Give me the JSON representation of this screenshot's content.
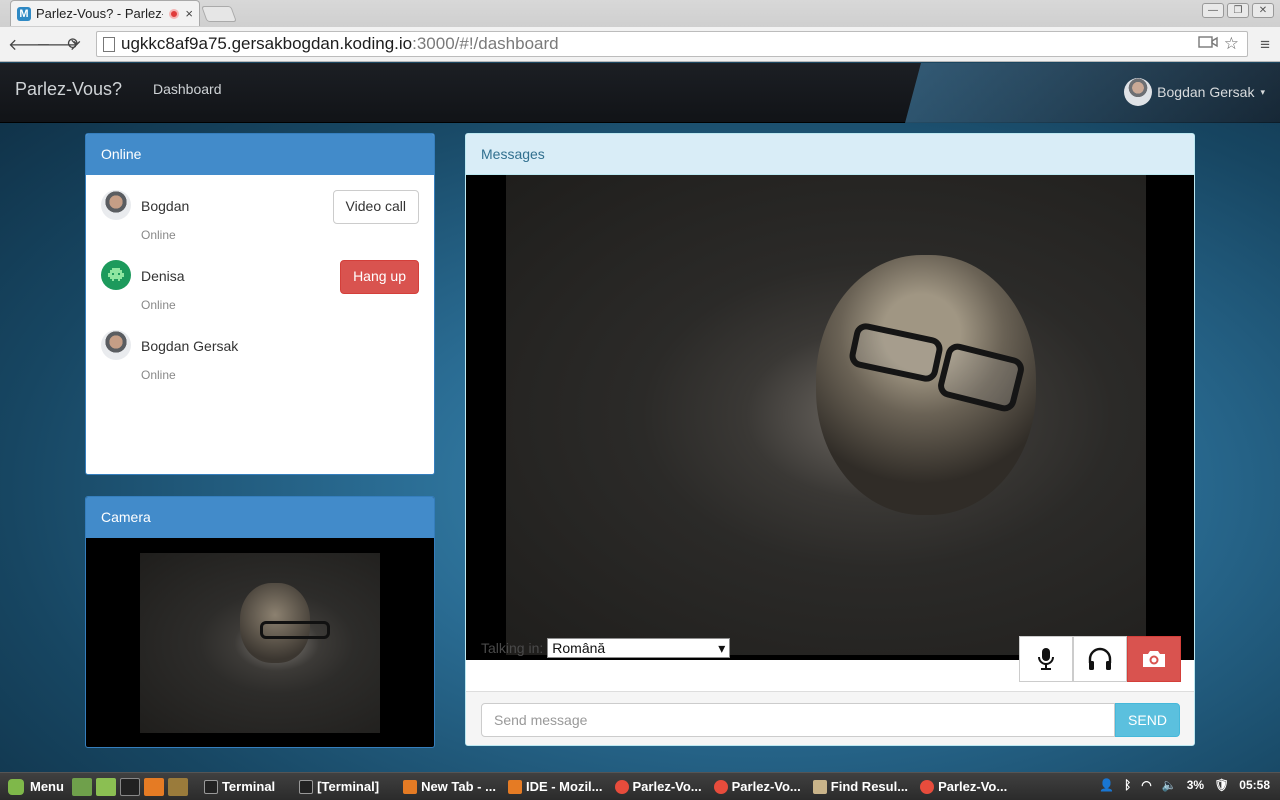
{
  "browser": {
    "tab_favicon": "M",
    "tab_title": "Parlez-Vous? - Parlez-",
    "tab_close": "×",
    "url_host": "ugkkc8af9a75.gersakbogdan.koding.io",
    "url_rest": ":3000/#!/dashboard",
    "back": "🡐",
    "forward": "🡒",
    "reload": "⟳",
    "star": "☆",
    "menu": "≡",
    "window_buttons": [
      "—",
      "❐",
      "✕"
    ]
  },
  "navbar": {
    "brand": "Parlez-Vous?",
    "dashboard": "Dashboard",
    "user_name": "Bogdan Gersak",
    "caret": "▾"
  },
  "online": {
    "title": "Online",
    "contacts": [
      {
        "name": "Bogdan",
        "status": "Online",
        "action": "Video call"
      },
      {
        "name": "Denisa",
        "status": "Online",
        "action": "Hang up"
      },
      {
        "name": "Bogdan Gersak",
        "status": "Online"
      }
    ]
  },
  "camera": {
    "title": "Camera"
  },
  "messages": {
    "title": "Messages",
    "talking_in": "Talking in:",
    "language": "Română",
    "placeholder": "Send message",
    "send": "SEND"
  },
  "taskbar": {
    "menu": "Menu",
    "tasks": [
      "Terminal",
      "[Terminal]",
      "New Tab - ...",
      "IDE - Mozil...",
      "Parlez-Vo...",
      "Parlez-Vo...",
      "Find Resul...",
      "Parlez-Vo..."
    ],
    "battery": "3%",
    "clock": "05:58"
  },
  "colors": {
    "primary": "#428bca",
    "danger": "#d9534f",
    "info": "#5bc0de",
    "info_bg": "#d9edf7"
  },
  "icons": [
    "microphone-icon",
    "headphones-icon",
    "camera-icon",
    "star-icon",
    "menu-icon"
  ]
}
